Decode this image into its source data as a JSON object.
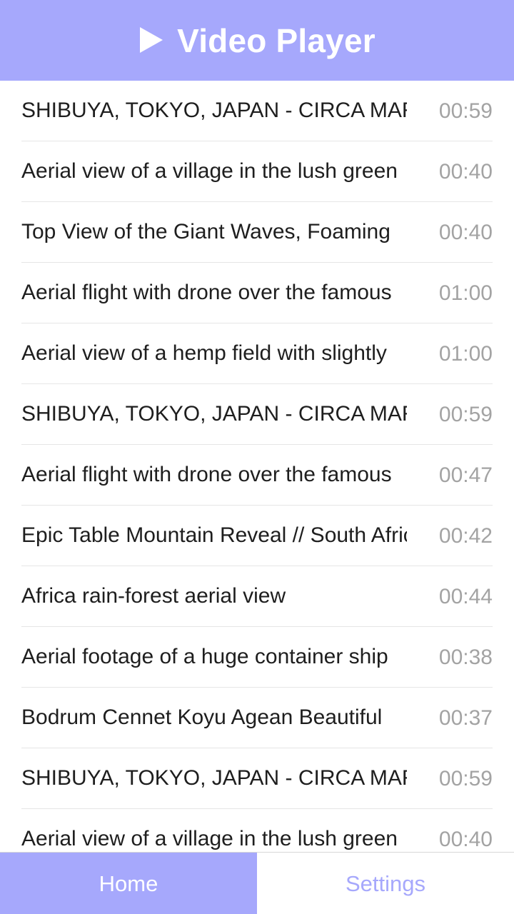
{
  "header": {
    "icon": "play-icon",
    "title": "Video Player",
    "color": "#a6a8fc"
  },
  "videos": [
    {
      "title": "SHIBUYA, TOKYO, JAPAN - CIRCA MARCH",
      "duration": "00:59"
    },
    {
      "title": "Aerial view of a village in the lush green",
      "duration": "00:40"
    },
    {
      "title": "Top View of the Giant Waves, Foaming",
      "duration": "00:40"
    },
    {
      "title": "Aerial flight with drone over the famous",
      "duration": "01:00"
    },
    {
      "title": "Aerial view of a hemp field with slightly",
      "duration": "01:00"
    },
    {
      "title": "SHIBUYA, TOKYO, JAPAN - CIRCA MARCH",
      "duration": "00:59"
    },
    {
      "title": "Aerial flight with drone over the famous",
      "duration": "00:47"
    },
    {
      "title": "Epic Table Mountain Reveal // South Africa",
      "duration": "00:42"
    },
    {
      "title": "Africa rain-forest aerial view",
      "duration": "00:44"
    },
    {
      "title": "Aerial footage of a huge container ship",
      "duration": "00:38"
    },
    {
      "title": "Bodrum Cennet Koyu Agean Beautiful",
      "duration": "00:37"
    },
    {
      "title": "SHIBUYA, TOKYO, JAPAN - CIRCA MARCH",
      "duration": "00:59"
    },
    {
      "title": "Aerial view of a village in the lush green",
      "duration": "00:40"
    }
  ],
  "tabs": {
    "home": "Home",
    "settings": "Settings"
  }
}
